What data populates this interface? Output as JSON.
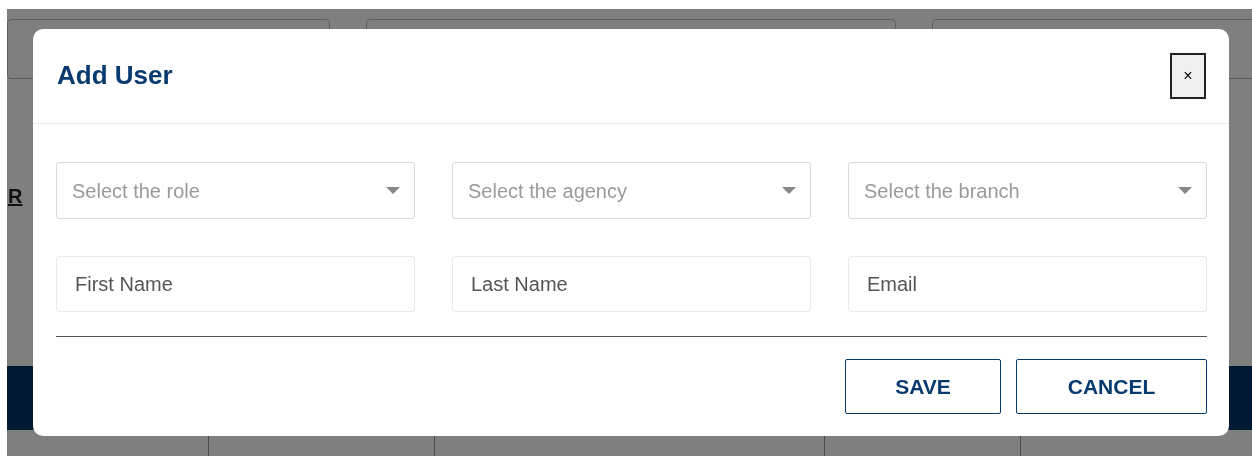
{
  "background": {
    "link_text": "R"
  },
  "modal": {
    "title": "Add User",
    "close": "×",
    "selects": [
      {
        "placeholder": "Select the role"
      },
      {
        "placeholder": "Select the agency"
      },
      {
        "placeholder": "Select the branch"
      }
    ],
    "inputs": [
      {
        "placeholder": "First Name"
      },
      {
        "placeholder": "Last Name"
      },
      {
        "placeholder": "Email"
      }
    ],
    "buttons": [
      {
        "label": "SAVE"
      },
      {
        "label": "CANCEL"
      }
    ]
  }
}
